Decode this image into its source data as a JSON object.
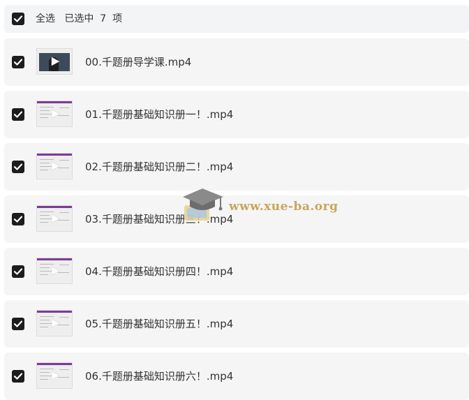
{
  "header": {
    "select_all_label": "全选",
    "selected_prefix": "已选中",
    "selected_count": "7",
    "selected_suffix": "项",
    "all_checked": true
  },
  "files": [
    {
      "name": "00.千题册导学课.mp4",
      "checked": true,
      "thumbnail": "video-intro-thumbnail"
    },
    {
      "name": "01.千题册基础知识册一！.mp4",
      "checked": true,
      "thumbnail": "video-slides-thumbnail"
    },
    {
      "name": "02.千题册基础知识册二！.mp4",
      "checked": true,
      "thumbnail": "video-slides-thumbnail"
    },
    {
      "name": "03.千题册基础知识册三！.mp4",
      "checked": true,
      "thumbnail": "video-slides-thumbnail"
    },
    {
      "name": "04.千题册基础知识册四！.mp4",
      "checked": true,
      "thumbnail": "video-slides-thumbnail"
    },
    {
      "name": "05.千题册基础知识册五！.mp4",
      "checked": true,
      "thumbnail": "video-slides-thumbnail"
    },
    {
      "name": "06.千题册基础知识册六！.mp4",
      "checked": true,
      "thumbnail": "video-slides-thumbnail"
    }
  ],
  "watermark": {
    "text": "www.xue-ba.org",
    "icon": "graduation-cap-icon"
  },
  "colors": {
    "checkbox": "#1d1d1d",
    "row_bg": "#f5f5f6",
    "thumb_accent": "#7b3b99",
    "watermark": "#c8a55a"
  }
}
